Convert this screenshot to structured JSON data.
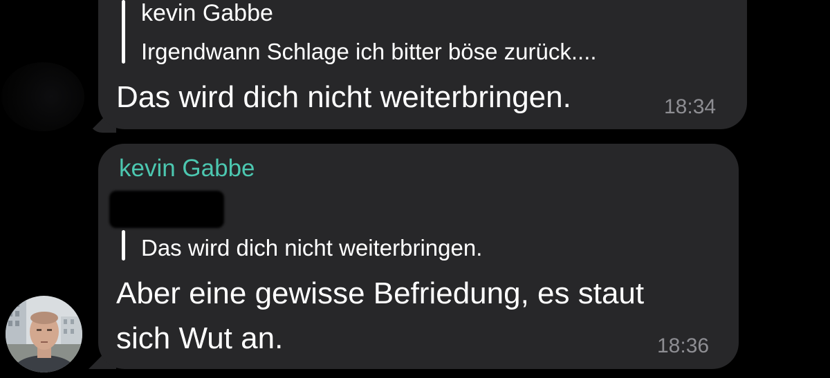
{
  "messages": [
    {
      "reply": {
        "name": "kevin Gabbe",
        "text": "Irgendwann Schlage ich bitter böse zurück...."
      },
      "text": "Das wird dich nicht weiterbringen.",
      "time": "18:34"
    },
    {
      "sender": "kevin Gabbe",
      "reply": {
        "name": "",
        "text": "Das wird dich nicht weiterbringen."
      },
      "text_line1": "Aber eine gewisse Befriedung, es staut",
      "text_line2": "sich Wut an.",
      "time": "18:36"
    }
  ],
  "colors": {
    "background": "#000000",
    "bubble": "#272729",
    "sender_name": "#4cc7b0",
    "timestamp": "#8e8e93"
  },
  "avatar": {
    "icon": "user-avatar-photo"
  }
}
